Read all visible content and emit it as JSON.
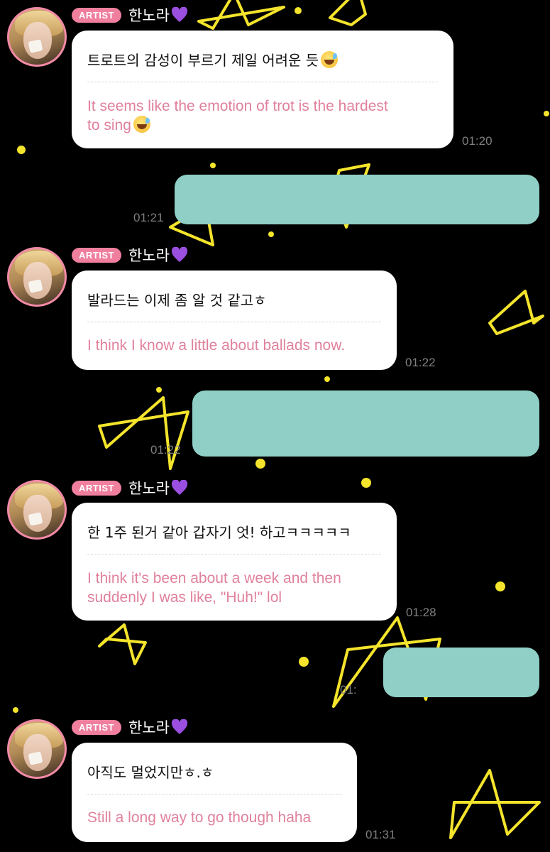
{
  "badge_label": "ARTIST",
  "artist_name": "한노라",
  "colors": {
    "badge": "#f07f9e",
    "translation_text": "#e0819c",
    "sent_bubble": "#8fcfc6",
    "background": "#000000",
    "star": "#f4e42c"
  },
  "messages": [
    {
      "original": "트로트의 감성이 부르기 제일 어려운 듯",
      "translation_line1": "It seems like the emotion of trot is the hardest",
      "translation_line2": "to sing",
      "time": "01:20"
    },
    {
      "original": "발라드는 이제 좀 알 것 같고ㅎ",
      "translation_line1": "I think I know a little about ballads now.",
      "time": "01:22"
    },
    {
      "original": "한 1주 된거 같아 갑자기 엇! 하고ㅋㅋㅋㅋㅋ",
      "translation_line1": "I think it's been about a week and then",
      "translation_line2": "suddenly I was like, \"Huh!\" lol",
      "time": "01:28"
    },
    {
      "original": "아직도 멀었지만ㅎ.ㅎ",
      "translation_line1": "Still a long way to go though haha",
      "time": "01:31"
    }
  ],
  "sent_times": [
    "01:21",
    "01:22",
    "01:"
  ]
}
